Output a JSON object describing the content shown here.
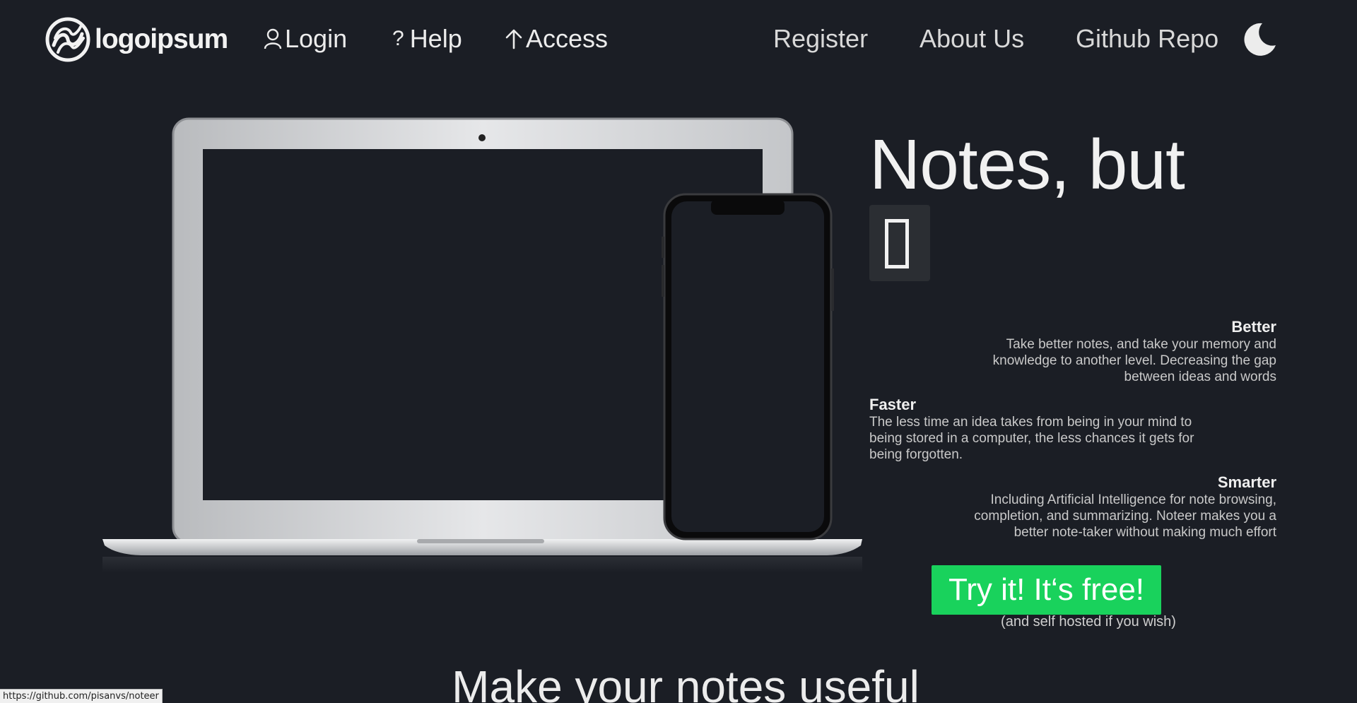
{
  "nav": {
    "logo_text": "logoipsum",
    "login": "Login",
    "help": "Help",
    "access": "Access",
    "register": "Register",
    "about": "About Us",
    "github": "Github Repo",
    "theme_icon": "moon-icon"
  },
  "hero": {
    "title": "Notes, but",
    "features": [
      {
        "title": "Better",
        "text": "Take better notes, and take your memory and knowledge to another level. Decreasing the gap between ideas and words"
      },
      {
        "title": "Faster",
        "text": "The less time an idea takes from being in your mind to being stored in a computer, the less chances it gets for being forgotten."
      },
      {
        "title": "Smarter",
        "text": "Including Artificial Intelligence for note browsing, completion, and summarizing. Noteer makes you a better note-taker without making much effort"
      }
    ],
    "cta_label": "Try it! It‘s free!",
    "cta_sub": "(and self hosted if you wish)"
  },
  "section": {
    "title": "Make your notes useful"
  },
  "status_bar": {
    "link_url": "https://github.com/pisanvs/noteer"
  },
  "colors": {
    "background": "#1b1e25",
    "cta": "#19d25c",
    "text": "#e9e9ea"
  }
}
